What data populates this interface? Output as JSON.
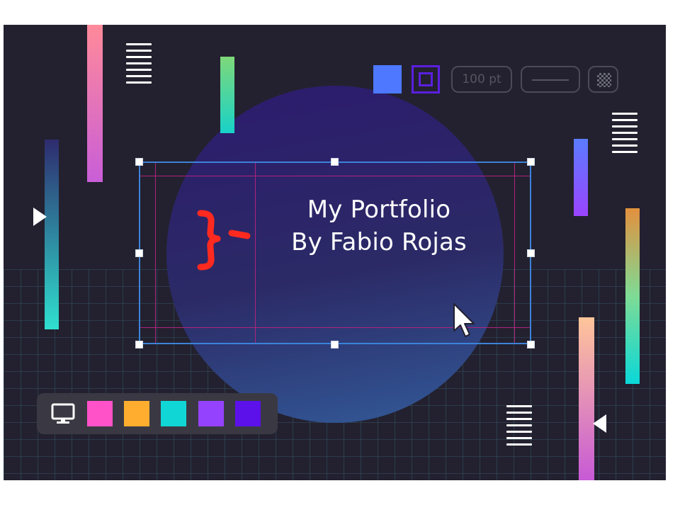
{
  "title": {
    "line1": "My Portfolio",
    "line2": "By Fabio Rojas"
  },
  "toolbar": {
    "fill_color": "#4d78ff",
    "stroke_color": "#5a1fe0",
    "stroke_size": "100 pt",
    "icons": [
      "fill-swatch",
      "stroke-swatch",
      "line-style-icon",
      "transparency-icon"
    ]
  },
  "palette": {
    "device_icon": "monitor-icon",
    "colors": [
      "#ff52c8",
      "#ffad2e",
      "#11d6d6",
      "#9542ff",
      "#5c10ea"
    ]
  },
  "colors": {
    "canvas_background": "#23212f",
    "selection_border": "#3b83d9",
    "guide_lines": "#b0237d",
    "logo": "#ff2a1f"
  }
}
